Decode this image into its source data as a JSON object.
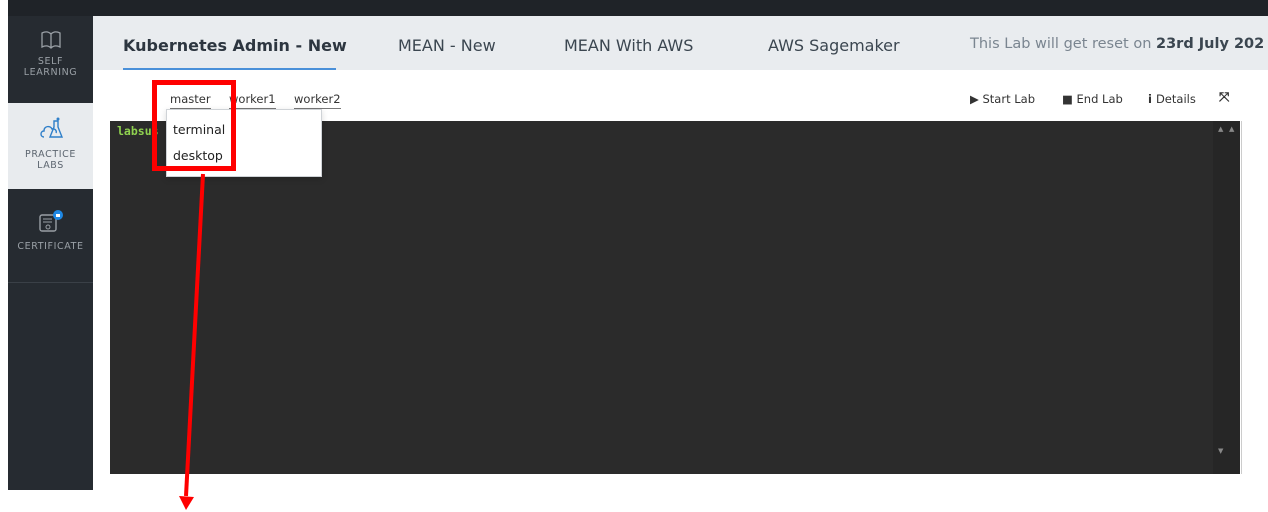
{
  "sidebar": {
    "items": [
      {
        "label_1": "SELF",
        "label_2": "LEARNING",
        "icon": "book-icon"
      },
      {
        "label_1": "PRACTICE",
        "label_2": "LABS",
        "icon": "flask-cloud-icon"
      },
      {
        "label_1": "CERTIFICATE",
        "icon": "certificate-lock-icon"
      }
    ]
  },
  "tabs": [
    {
      "label": "Kubernetes Admin - New",
      "active": true
    },
    {
      "label": "MEAN - New"
    },
    {
      "label": "MEAN With AWS"
    },
    {
      "label": "AWS Sagemaker"
    }
  ],
  "reset_note": {
    "prefix": "This Lab will get reset on ",
    "date": "23rd July 202"
  },
  "node_tabs": [
    "master",
    "worker1",
    "worker2"
  ],
  "toolbar": {
    "start": "Start Lab",
    "end": "End Lab",
    "details": "Details"
  },
  "terminal": {
    "prompt": "labsus"
  },
  "dropdown": {
    "items": [
      "terminal",
      "desktop"
    ]
  },
  "colors": {
    "highlight": "#ff0000",
    "accent": "#4a90d9",
    "prompt": "#8fd14f"
  }
}
